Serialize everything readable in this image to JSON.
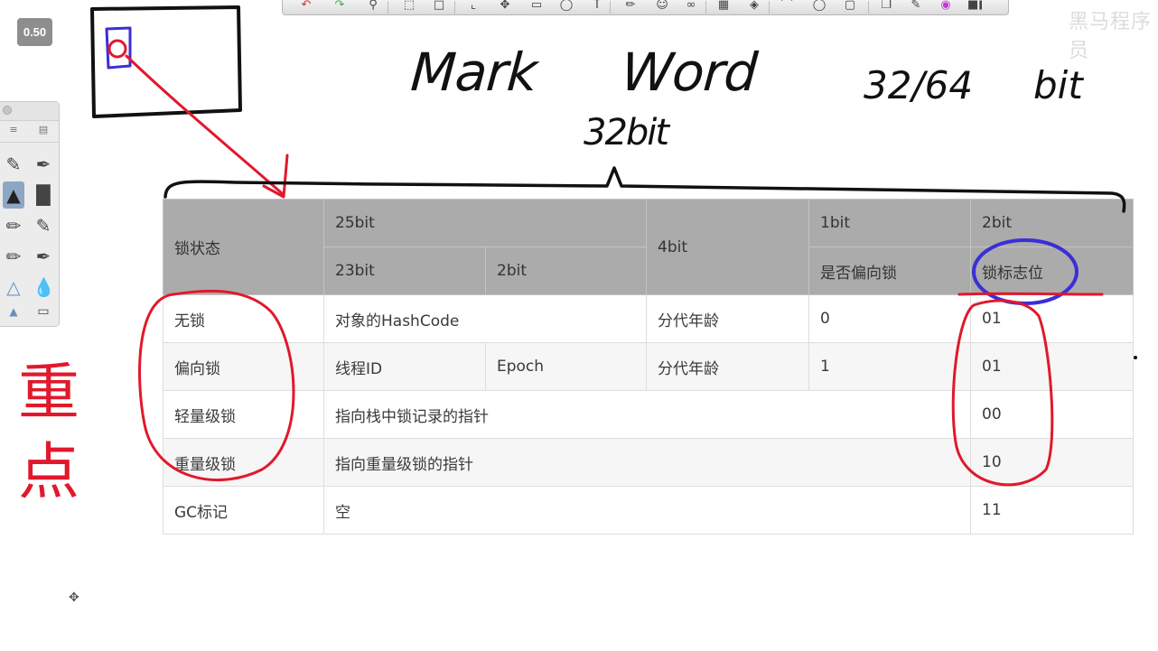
{
  "zoom_badge": "0.50",
  "watermark": "黑马程序员",
  "handwriting": {
    "title_left": "Mark",
    "title_right": "Word",
    "bits_total": "32/64",
    "bits_unit": "bit",
    "brace_label": "32bit",
    "side_note": "重点"
  },
  "table": {
    "header": {
      "lock_state": "锁状态",
      "bit25": "25bit",
      "bit23": "23bit",
      "bit2a": "2bit",
      "bit4": "4bit",
      "bit1": "1bit",
      "bit2b": "2bit",
      "biased_flag": "是否偏向锁",
      "lock_flag": "锁标志位"
    },
    "rows": [
      {
        "state": "无锁",
        "content": "对象的HashCode",
        "age": "分代年龄",
        "biased": "0",
        "flag": "01"
      },
      {
        "state": "偏向锁",
        "thread": "线程ID",
        "epoch": "Epoch",
        "age": "分代年龄",
        "biased": "1",
        "flag": "01"
      },
      {
        "state": "轻量级锁",
        "content": "指向栈中锁记录的指针",
        "flag": "00"
      },
      {
        "state": "重量级锁",
        "content": "指向重量级锁的指针",
        "flag": "10"
      },
      {
        "state": "GC标记",
        "content": "空",
        "flag": "11"
      }
    ]
  },
  "colors": {
    "ink_black": "#111111",
    "ink_red": "#e0192c",
    "ink_blue": "#3a2fd6",
    "header_gray": "#ababab"
  },
  "toolbar_icons": [
    "undo-icon",
    "redo-icon",
    "zoom-icon",
    "select-icon",
    "marquee-icon",
    "crop-icon",
    "transform-icon",
    "rectangle-icon",
    "cylinder-icon",
    "text-icon",
    "ruler-icon",
    "emoji-icon",
    "symmetry-icon",
    "grid-icon",
    "perspective-icon",
    "curve-icon",
    "ellipse-icon",
    "shape-icon",
    "layers-icon",
    "brush-library-icon",
    "color-wheel-icon",
    "more-icon"
  ],
  "tool_panel_icons": [
    "sliders-icon",
    "brush-list-icon",
    "pencil-icon",
    "fountain-pen-icon",
    "marker-icon",
    "highlighter-icon",
    "ink-pen-icon",
    "chisel-icon",
    "brush-pen-icon",
    "calligraphy-icon",
    "airbrush-icon",
    "blender-icon",
    "triangle-icon",
    "eraser-icon"
  ]
}
